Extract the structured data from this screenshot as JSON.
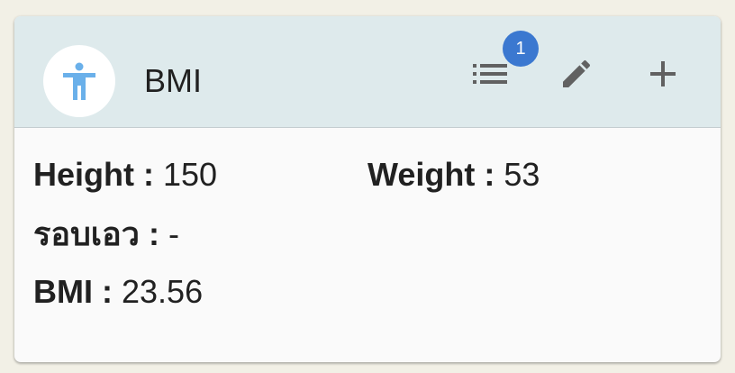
{
  "card": {
    "title": "BMI",
    "avatar_icon": "accessibility-icon",
    "badge_count": "1",
    "actions": {
      "list_icon": "list-icon",
      "edit_icon": "edit-icon",
      "add_icon": "add-icon"
    }
  },
  "fields": {
    "height": {
      "label": "Height :",
      "value": "150"
    },
    "weight": {
      "label": "Weight :",
      "value": "53"
    },
    "waist": {
      "label": "รอบเอว :",
      "value": "-"
    },
    "bmi": {
      "label": "BMI :",
      "value": "23.56"
    }
  },
  "colors": {
    "header_bg": "#deeaec",
    "badge_bg": "#3b78d0",
    "avatar_icon": "#6ab0ea",
    "icon_gray": "#616161"
  }
}
